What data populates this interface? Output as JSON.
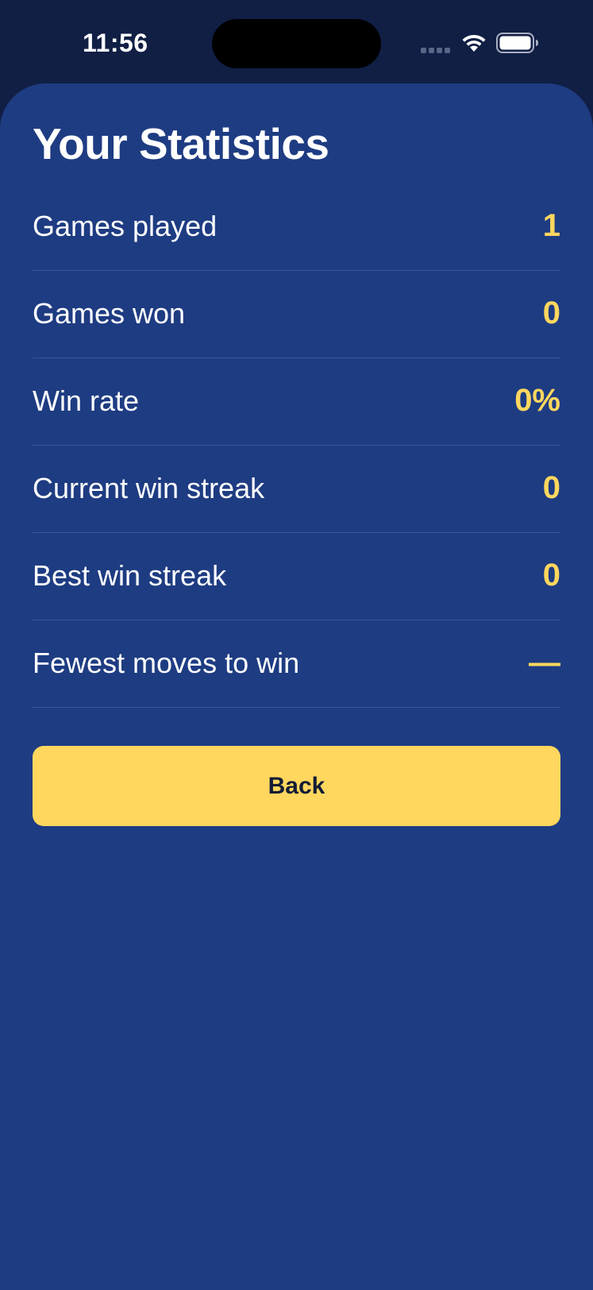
{
  "status_bar": {
    "time": "11:56",
    "signal_icon": "cellular-signal-icon",
    "wifi_icon": "wifi-icon",
    "battery_icon": "battery-icon"
  },
  "header": {
    "title": "Your Statistics"
  },
  "stats": [
    {
      "label": "Games played",
      "value": "1"
    },
    {
      "label": "Games won",
      "value": "0"
    },
    {
      "label": "Win rate",
      "value": "0%"
    },
    {
      "label": "Current win streak",
      "value": "0"
    },
    {
      "label": "Best win streak",
      "value": "0"
    },
    {
      "label": "Fewest moves to win",
      "value": "—"
    }
  ],
  "actions": {
    "back_label": "Back"
  },
  "colors": {
    "background": "#111f45",
    "sheet": "#1e3c82",
    "accent": "#ffd75e",
    "text": "#ffffff",
    "button_text": "#121c35"
  }
}
